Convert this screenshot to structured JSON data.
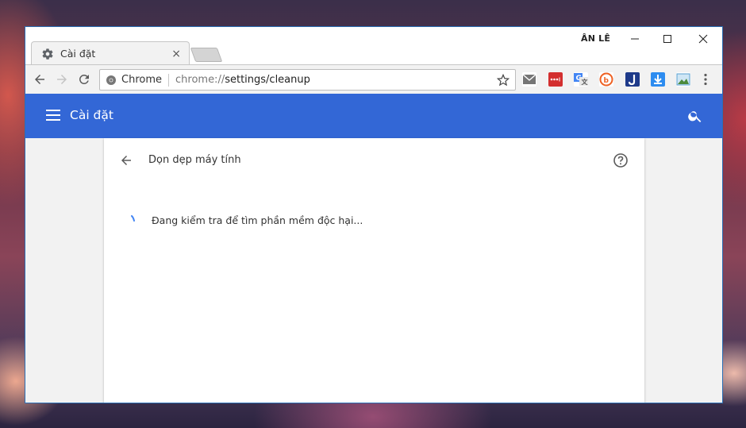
{
  "tab": {
    "title": "Cài đặt",
    "close": "×"
  },
  "profile": {
    "name": "ÂN LÊ"
  },
  "omnibox": {
    "chip_label": "Chrome",
    "url_scheme": "chrome://",
    "url_path": "settings/cleanup"
  },
  "extensions": [
    {
      "name": "gmail-icon",
      "color": "#757575"
    },
    {
      "name": "lastpass-icon",
      "color": "#d32f2f"
    },
    {
      "name": "google-translate-icon",
      "color": "#4285f4"
    },
    {
      "name": "bitly-icon",
      "color": "#ee6123"
    },
    {
      "name": "j-extension-icon",
      "color": "#1e3a8a"
    },
    {
      "name": "download-icon",
      "color": "#2d8cf0"
    },
    {
      "name": "image-extension-icon",
      "color": "#5aa0d0"
    }
  ],
  "settings": {
    "title": "Cài đặt"
  },
  "cleanup": {
    "title": "Dọn dẹp máy tính",
    "status": "Đang kiểm tra để tìm phần mềm độc hại..."
  },
  "colors": {
    "accent": "#3367d6",
    "spinner": "#4285f4"
  }
}
